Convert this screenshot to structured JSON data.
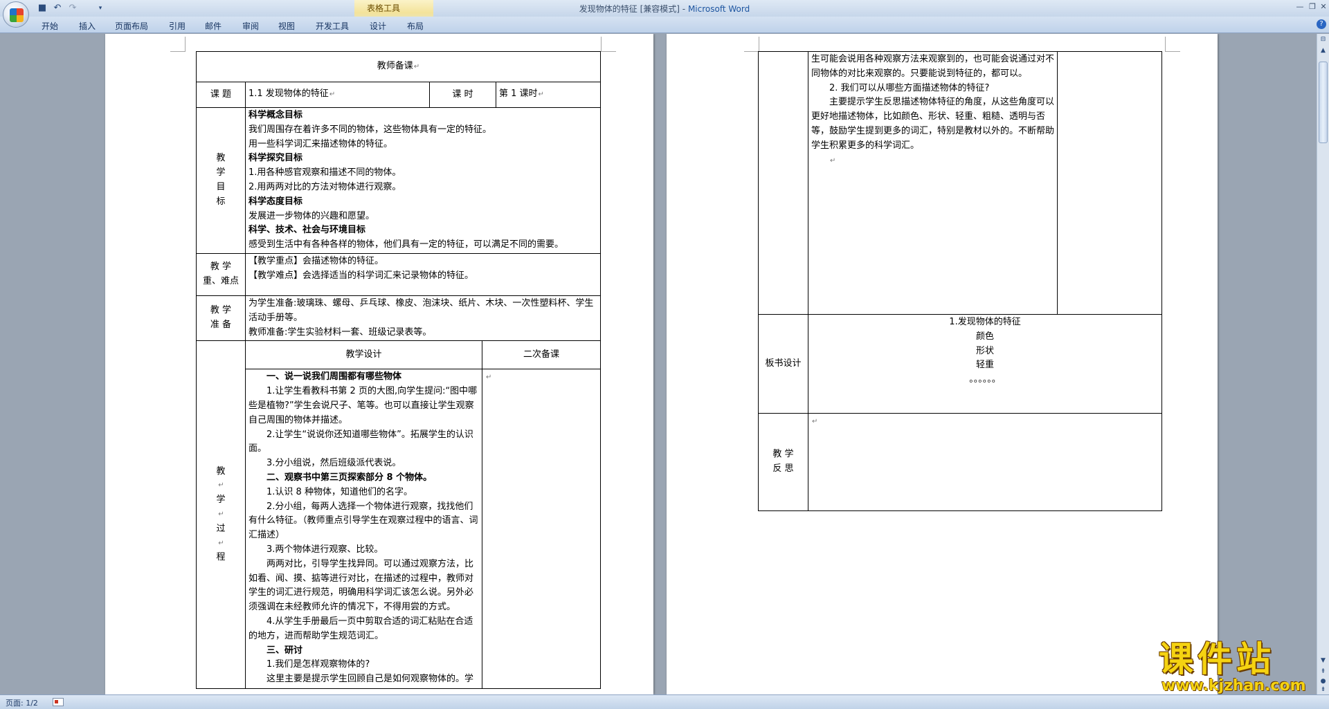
{
  "window": {
    "title": "发现物体的特征 [兼容模式]",
    "app_name": "Microsoft Word",
    "title_separator": " - ",
    "context_tab_group": "表格工具",
    "buttons": [
      "minimize-icon",
      "restore-icon",
      "close-icon"
    ]
  },
  "ribbon": {
    "tabs": [
      "开始",
      "插入",
      "页面布局",
      "引用",
      "邮件",
      "审阅",
      "视图",
      "开发工具",
      "设计",
      "布局"
    ]
  },
  "status": {
    "page": "页面: 1/2"
  },
  "doc": {
    "title": "教师备课",
    "topic_label": "课  题",
    "topic_value": "1.1 发现物体的特征",
    "hours_label": "课    时",
    "hours_value": "第 1 课时",
    "goals_label": [
      "教",
      "学",
      "目",
      "标"
    ],
    "goals": [
      {
        "bold": true,
        "text": "科学概念目标"
      },
      {
        "bold": false,
        "text": "我们周围存在着许多不同的物体，这些物体具有一定的特征。"
      },
      {
        "bold": false,
        "text": "用一些科学词汇来描述物体的特征。"
      },
      {
        "bold": true,
        "text": "科学探究目标"
      },
      {
        "bold": false,
        "text": "1.用各种感官观察和描述不同的物体。"
      },
      {
        "bold": false,
        "text": "2.用两两对比的方法对物体进行观察。"
      },
      {
        "bold": true,
        "text": "科学态度目标"
      },
      {
        "bold": false,
        "text": "发展进一步物体的兴趣和愿望。"
      },
      {
        "bold": true,
        "text": "科学、技术、社会与环境目标"
      },
      {
        "bold": false,
        "text": "感受到生活中有各种各样的物体，他们具有一定的特征，可以满足不同的需要。"
      }
    ],
    "keypoints_label": [
      "教  学",
      "重、难点"
    ],
    "keypoints": [
      "【教学重点】会描述物体的特征。",
      "【教学难点】会选择适当的科学词汇来记录物体的特征。"
    ],
    "prep_label": [
      "教  学",
      "准  备"
    ],
    "prep": [
      "为学生准备:玻璃珠、螺母、乒乓球、橡皮、泡沫块、纸片、木块、一次性塑料杯、学生活动手册等。",
      "教师准备:学生实验材料一套、班级记录表等。"
    ],
    "process_label": [
      "教",
      "学",
      "过",
      "程"
    ],
    "design_header": "教学设计",
    "second_header": "二次备课",
    "process": [
      {
        "bold": true,
        "text": "一、说一说我们周围都有哪些物体"
      },
      {
        "bold": false,
        "text": "1.让学生看教科书第 2 页的大图,向学生提问:“图中哪些是植物?”学生会说尺子、笔等。也可以直接让学生观察自己周围的物体并描述。"
      },
      {
        "bold": false,
        "text": "2.让学生“说说你还知道哪些物体”。拓展学生的认识面。"
      },
      {
        "bold": false,
        "text": "3.分小组说，然后班级派代表说。"
      },
      {
        "bold": true,
        "text": "二、观察书中第三页探索部分 8 个物体。"
      },
      {
        "bold": false,
        "text": "1.认识 8 种物体，知道他们的名字。"
      },
      {
        "bold": false,
        "text": "2.分小组，每两人选择一个物体进行观察，找找他们有什么特征。（教师重点引导学生在观察过程中的语言、词汇描述）"
      },
      {
        "bold": false,
        "text": "3.两个物体进行观察、比较。"
      },
      {
        "bold": false,
        "text": "两两对比，引导学生找异同。可以通过观察方法，比如看、闻、摸、掂等进行对比，在描述的过程中，教师对学生的词汇进行规范，明确用科学词汇该怎么说。另外必须强调在未经教师允许的情况下，不得用尝的方式。"
      },
      {
        "bold": false,
        "text": "4.从学生手册最后一页中剪取合适的词汇粘贴在合适的地方，进而帮助学生规范词汇。"
      },
      {
        "bold": true,
        "text": "三、研讨"
      },
      {
        "bold": false,
        "text": "1.我们是怎样观察物体的?"
      },
      {
        "bold": false,
        "text": "这里主要是提示学生回顾自己是如何观察物体的。学"
      }
    ],
    "page2_process": [
      "生可能会说用各种观察方法来观察到的，也可能会说通过对不同物体的对比来观察的。只要能说到特征的，都可以。",
      "2. 我们可以从哪些方面描述物体的特征?",
      "主要提示学生反思描述物体特征的角度，从这些角度可以更好地描述物体，比如颜色、形状、轻重、粗糙、透明与否等，鼓励学生提到更多的词汇，特别是教材以外的。不断帮助学生积累更多的科学词汇。"
    ],
    "board_label": "板书设计",
    "board": [
      "1.发现物体的特征",
      "颜色",
      "形状",
      "轻重",
      "。。。。。。"
    ],
    "reflect_label": [
      "教  学",
      "反  思"
    ]
  },
  "watermark": {
    "cn": "课件站",
    "url": "www.kjzhan.com"
  }
}
